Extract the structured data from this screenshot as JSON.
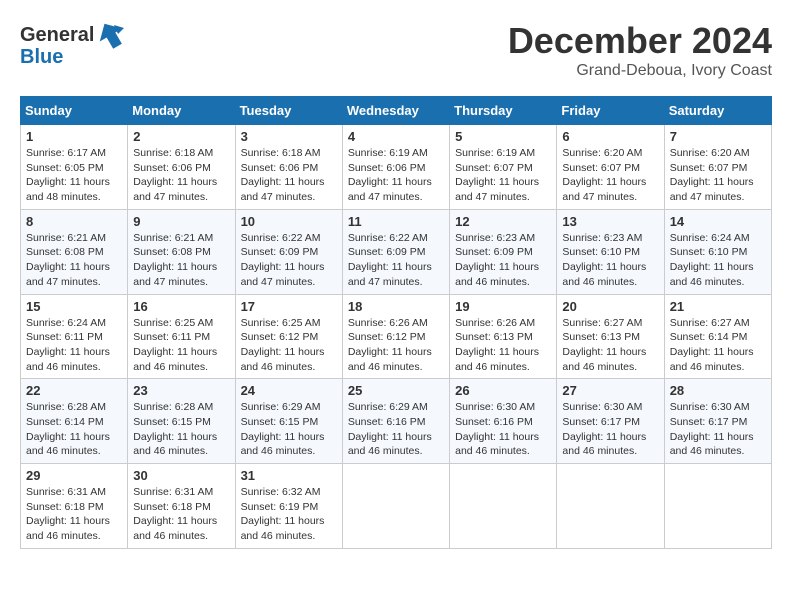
{
  "header": {
    "logo_line1": "General",
    "logo_line2": "Blue",
    "month_title": "December 2024",
    "subtitle": "Grand-Deboua, Ivory Coast"
  },
  "weekdays": [
    "Sunday",
    "Monday",
    "Tuesday",
    "Wednesday",
    "Thursday",
    "Friday",
    "Saturday"
  ],
  "weeks": [
    [
      {
        "day": "1",
        "info": "Sunrise: 6:17 AM\nSunset: 6:05 PM\nDaylight: 11 hours and 48 minutes."
      },
      {
        "day": "2",
        "info": "Sunrise: 6:18 AM\nSunset: 6:06 PM\nDaylight: 11 hours and 47 minutes."
      },
      {
        "day": "3",
        "info": "Sunrise: 6:18 AM\nSunset: 6:06 PM\nDaylight: 11 hours and 47 minutes."
      },
      {
        "day": "4",
        "info": "Sunrise: 6:19 AM\nSunset: 6:06 PM\nDaylight: 11 hours and 47 minutes."
      },
      {
        "day": "5",
        "info": "Sunrise: 6:19 AM\nSunset: 6:07 PM\nDaylight: 11 hours and 47 minutes."
      },
      {
        "day": "6",
        "info": "Sunrise: 6:20 AM\nSunset: 6:07 PM\nDaylight: 11 hours and 47 minutes."
      },
      {
        "day": "7",
        "info": "Sunrise: 6:20 AM\nSunset: 6:07 PM\nDaylight: 11 hours and 47 minutes."
      }
    ],
    [
      {
        "day": "8",
        "info": "Sunrise: 6:21 AM\nSunset: 6:08 PM\nDaylight: 11 hours and 47 minutes."
      },
      {
        "day": "9",
        "info": "Sunrise: 6:21 AM\nSunset: 6:08 PM\nDaylight: 11 hours and 47 minutes."
      },
      {
        "day": "10",
        "info": "Sunrise: 6:22 AM\nSunset: 6:09 PM\nDaylight: 11 hours and 47 minutes."
      },
      {
        "day": "11",
        "info": "Sunrise: 6:22 AM\nSunset: 6:09 PM\nDaylight: 11 hours and 47 minutes."
      },
      {
        "day": "12",
        "info": "Sunrise: 6:23 AM\nSunset: 6:09 PM\nDaylight: 11 hours and 46 minutes."
      },
      {
        "day": "13",
        "info": "Sunrise: 6:23 AM\nSunset: 6:10 PM\nDaylight: 11 hours and 46 minutes."
      },
      {
        "day": "14",
        "info": "Sunrise: 6:24 AM\nSunset: 6:10 PM\nDaylight: 11 hours and 46 minutes."
      }
    ],
    [
      {
        "day": "15",
        "info": "Sunrise: 6:24 AM\nSunset: 6:11 PM\nDaylight: 11 hours and 46 minutes."
      },
      {
        "day": "16",
        "info": "Sunrise: 6:25 AM\nSunset: 6:11 PM\nDaylight: 11 hours and 46 minutes."
      },
      {
        "day": "17",
        "info": "Sunrise: 6:25 AM\nSunset: 6:12 PM\nDaylight: 11 hours and 46 minutes."
      },
      {
        "day": "18",
        "info": "Sunrise: 6:26 AM\nSunset: 6:12 PM\nDaylight: 11 hours and 46 minutes."
      },
      {
        "day": "19",
        "info": "Sunrise: 6:26 AM\nSunset: 6:13 PM\nDaylight: 11 hours and 46 minutes."
      },
      {
        "day": "20",
        "info": "Sunrise: 6:27 AM\nSunset: 6:13 PM\nDaylight: 11 hours and 46 minutes."
      },
      {
        "day": "21",
        "info": "Sunrise: 6:27 AM\nSunset: 6:14 PM\nDaylight: 11 hours and 46 minutes."
      }
    ],
    [
      {
        "day": "22",
        "info": "Sunrise: 6:28 AM\nSunset: 6:14 PM\nDaylight: 11 hours and 46 minutes."
      },
      {
        "day": "23",
        "info": "Sunrise: 6:28 AM\nSunset: 6:15 PM\nDaylight: 11 hours and 46 minutes."
      },
      {
        "day": "24",
        "info": "Sunrise: 6:29 AM\nSunset: 6:15 PM\nDaylight: 11 hours and 46 minutes."
      },
      {
        "day": "25",
        "info": "Sunrise: 6:29 AM\nSunset: 6:16 PM\nDaylight: 11 hours and 46 minutes."
      },
      {
        "day": "26",
        "info": "Sunrise: 6:30 AM\nSunset: 6:16 PM\nDaylight: 11 hours and 46 minutes."
      },
      {
        "day": "27",
        "info": "Sunrise: 6:30 AM\nSunset: 6:17 PM\nDaylight: 11 hours and 46 minutes."
      },
      {
        "day": "28",
        "info": "Sunrise: 6:30 AM\nSunset: 6:17 PM\nDaylight: 11 hours and 46 minutes."
      }
    ],
    [
      {
        "day": "29",
        "info": "Sunrise: 6:31 AM\nSunset: 6:18 PM\nDaylight: 11 hours and 46 minutes."
      },
      {
        "day": "30",
        "info": "Sunrise: 6:31 AM\nSunset: 6:18 PM\nDaylight: 11 hours and 46 minutes."
      },
      {
        "day": "31",
        "info": "Sunrise: 6:32 AM\nSunset: 6:19 PM\nDaylight: 11 hours and 46 minutes."
      },
      null,
      null,
      null,
      null
    ]
  ]
}
